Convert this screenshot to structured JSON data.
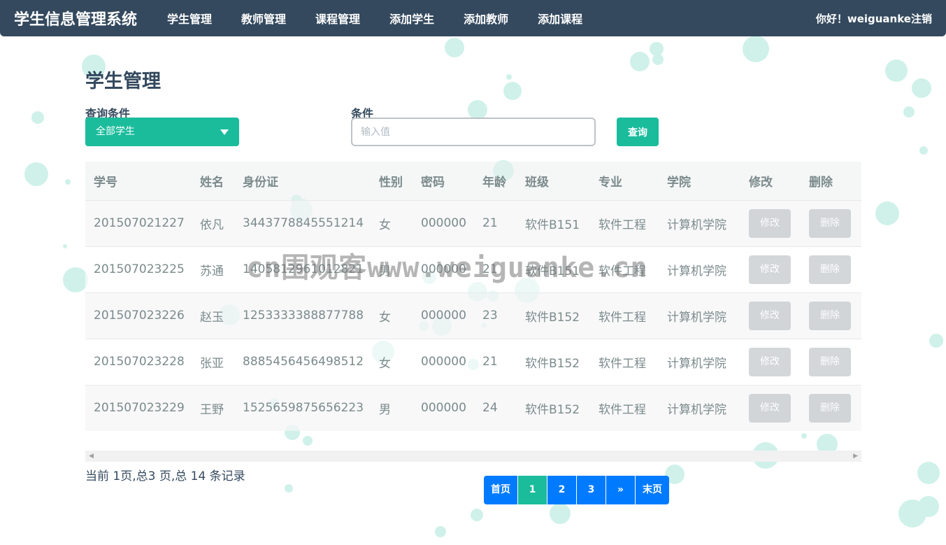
{
  "navbar": {
    "brand": "学生信息管理系统",
    "items": [
      "学生管理",
      "教师管理",
      "课程管理",
      "添加学生",
      "添加教师",
      "添加课程"
    ],
    "greeting": "你好！weiguanke",
    "logout": "注销"
  },
  "page": {
    "title": "学生管理",
    "filter_label": "查询条件",
    "filter_value": "全部学生",
    "condition_label": "条件",
    "input_placeholder": "输入值",
    "query_button": "查询"
  },
  "table": {
    "headers": [
      "学号",
      "姓名",
      "身份证",
      "性别",
      "密码",
      "年龄",
      "班级",
      "专业",
      "学院",
      "修改",
      "删除"
    ],
    "edit_label": "修改",
    "delete_label": "删除",
    "rows": [
      [
        "201507021227",
        "依凡",
        "3443778845551214",
        "女",
        "000000",
        "21",
        "软件B151",
        "软件工程",
        "计算机学院"
      ],
      [
        "201507023225",
        "苏通",
        "1405812961012821",
        "男",
        "000000",
        "21",
        "软件B151",
        "软件工程",
        "计算机学院"
      ],
      [
        "201507023226",
        "赵玉",
        "1253333388877788",
        "女",
        "000000",
        "23",
        "软件B152",
        "软件工程",
        "计算机学院"
      ],
      [
        "201507023228",
        "张亚",
        "8885456456498512",
        "女",
        "000000",
        "21",
        "软件B152",
        "软件工程",
        "计算机学院"
      ],
      [
        "201507023229",
        "王野",
        "1525659875656223",
        "男",
        "000000",
        "24",
        "软件B152",
        "软件工程",
        "计算机学院"
      ]
    ]
  },
  "footer": {
    "record_info": "当前 1页,总3 页,总 14 条记录",
    "pagination": [
      "首页",
      "1",
      "2",
      "3",
      "»",
      "末页"
    ],
    "active_page": "1"
  },
  "watermark": "cn围观客www.weiguanke.cn",
  "colors": {
    "navbar": "#34495e",
    "accent": "#1abc9c",
    "pagination": "#007bff",
    "disabled_button": "#bdc3c7",
    "bubble": "#a8e6d8"
  },
  "icons": {
    "select_caret": "caret-down-icon",
    "scroll_left": "arrow-left-icon",
    "scroll_right": "arrow-right-icon"
  }
}
